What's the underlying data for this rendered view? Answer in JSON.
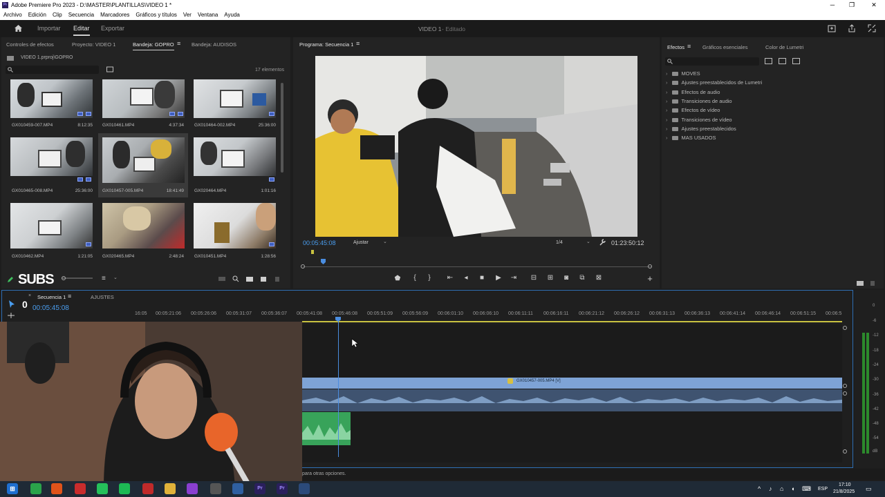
{
  "window": {
    "title": "Adobe Premiere Pro 2023 - D:\\MASTER\\PLANTILLAS\\VIDEO 1 *",
    "logo": "Pr"
  },
  "menu": [
    "Archivo",
    "Edición",
    "Clip",
    "Secuencia",
    "Marcadores",
    "Gráficos y títulos",
    "Ver",
    "Ventana",
    "Ayuda"
  ],
  "workspace": {
    "tabs": [
      "Importar",
      "Editar",
      "Exportar"
    ],
    "active": "Editar",
    "project_title": "VIDEO 1",
    "status": "- Editado"
  },
  "project_panel": {
    "tabs": [
      "Controles de efectos",
      "Proyecto: VIDEO 1",
      "Bandeja: GOPRO",
      "Bandeja: AUDISOS"
    ],
    "path": "VIDEO 1.prproj\\GOPRO",
    "count": "17 elementos",
    "clips": [
      {
        "name": "GX010459-007.MP4",
        "duration": "8:12:35"
      },
      {
        "name": "GX010461.MP4",
        "duration": "4:37:34"
      },
      {
        "name": "GX010464-002.MP4",
        "duration": "25:36:00"
      },
      {
        "name": "GX010465-008.MP4",
        "duration": "25:36:00"
      },
      {
        "name": "GX010457-005.MP4",
        "duration": "18:41:49"
      },
      {
        "name": "GX020464.MP4",
        "duration": "1:01:16"
      },
      {
        "name": "GX010462.MP4",
        "duration": "1:21:05"
      },
      {
        "name": "GX020465.MP4",
        "duration": "2:48:24"
      },
      {
        "name": "GX010451.MP4",
        "duration": "1:28:56"
      }
    ],
    "subs_label": "SUBS"
  },
  "program_monitor": {
    "tab": "Programa: Secuencia 1",
    "timecode": "00:05:45:08",
    "fit": "Ajustar",
    "quality": "1/4",
    "duration": "01:23:50:12"
  },
  "effects_panel": {
    "tabs": [
      "Efectos",
      "Gráficos esenciales",
      "Color de Lumetri"
    ],
    "items": [
      "MOVES",
      "Ajustes preestablecidos de Lumetri",
      "Efectos de audio",
      "Transiciones de audio",
      "Efectos de vídeo",
      "Transiciones de vídeo",
      "Ajustes preestablecidos",
      "MAS USADOS"
    ]
  },
  "timeline": {
    "tabs": [
      "Secuencia 1",
      "AJUSTES"
    ],
    "timecode": "00:05:45:08",
    "ruler": [
      "16:05",
      "00:05:21:06",
      "00:05:26:06",
      "00:05:31:07",
      "00:05:36:07",
      "00:05:41:08",
      "00:05:46:08",
      "00:05:51:09",
      "00:05:56:09",
      "00:06:01:10",
      "00:06:06:10",
      "00:06:11:11",
      "00:06:16:11",
      "00:06:21:12",
      "00:06:26:12",
      "00:06:31:13",
      "00:06:36:13",
      "00:06:41:14",
      "00:06:46:14",
      "00:06:51:15",
      "00:06:5"
    ],
    "clip_label": "GX010457-005.MP4 [V]",
    "status_hint": "para otras opciones.",
    "tools_number": "0",
    "meter_labels": [
      "0",
      "-6",
      "-12",
      "-18",
      "-24",
      "-30",
      "-36",
      "-42",
      "-48",
      "-54",
      "dB"
    ]
  },
  "taskbar": {
    "lang": "ESP",
    "time": "17:10",
    "date": "21/8/2025"
  },
  "colors": {
    "accent": "#2d8ceb",
    "clip_video": "#6f95cc",
    "clip_audio": "#3aaa5a",
    "playhead": "#4a8de0"
  }
}
